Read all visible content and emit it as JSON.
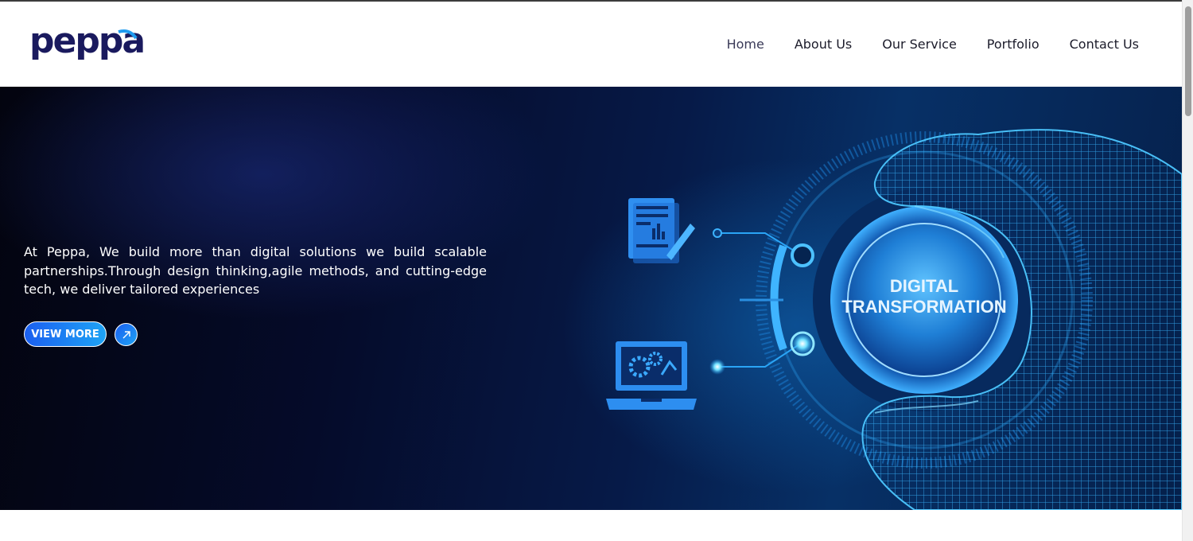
{
  "brand": {
    "logo_text": "peppa",
    "logo_color": "#1a1a5e",
    "accent_color": "#1e9bf0"
  },
  "nav": {
    "items": [
      {
        "label": "Home",
        "active": true
      },
      {
        "label": "About Us"
      },
      {
        "label": "Our Service"
      },
      {
        "label": "Portfolio"
      },
      {
        "label": "Contact Us"
      }
    ]
  },
  "hero": {
    "paragraph": "At Peppa, We build more than digital solutions we build scalable partnerships.Through design thinking,agile methods, and cutting-edge tech, we deliver tailored experiences",
    "cta_label": "VIEW MORE",
    "arrow_icon": "arrow-up-right-icon",
    "dial_line1": "DIGITAL",
    "dial_line2": "TRANSFORMATION",
    "illustration_icons": [
      "document-chart-icon",
      "laptop-gears-icon",
      "wireframe-hand-icon"
    ]
  }
}
